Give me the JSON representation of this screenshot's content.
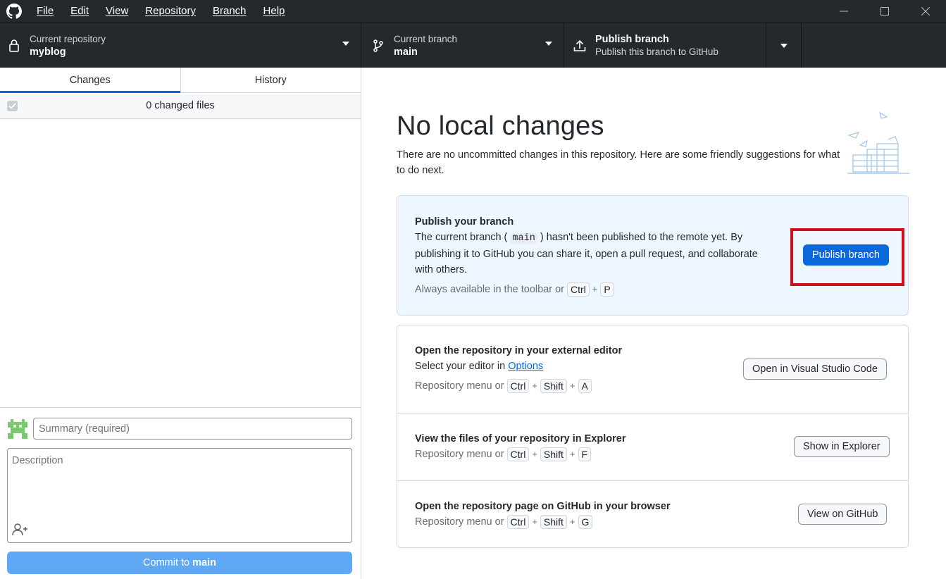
{
  "menu": {
    "items": [
      "File",
      "Edit",
      "View",
      "Repository",
      "Branch",
      "Help"
    ]
  },
  "toolbar": {
    "repo_label": "Current repository",
    "repo_value": "myblog",
    "branch_label": "Current branch",
    "branch_value": "main",
    "publish_title": "Publish branch",
    "publish_sub": "Publish this branch to GitHub"
  },
  "sidebar": {
    "tabs": [
      "Changes",
      "History"
    ],
    "active_tab": "Changes",
    "changed_files": "0 changed files",
    "summary_placeholder": "Summary (required)",
    "description_placeholder": "Description",
    "commit_prefix": "Commit to",
    "commit_branch": "main"
  },
  "main": {
    "heading": "No local changes",
    "subheading": "There are no uncommitted changes in this repository. Here are some friendly suggestions for what to do next.",
    "publish_card": {
      "title": "Publish your branch",
      "desc_before": "The current branch (",
      "desc_code": "main",
      "desc_after": ") hasn't been published to the remote yet. By publishing it to GitHub you can share it, open a pull request, and collaborate with others.",
      "hint": "Always available in the toolbar or",
      "keys": [
        "Ctrl",
        "P"
      ],
      "button": "Publish branch"
    },
    "editor_row": {
      "title": "Open the repository in your external editor",
      "desc": "Select your editor in",
      "link": "Options",
      "hint": "Repository menu or",
      "keys": [
        "Ctrl",
        "Shift",
        "A"
      ],
      "button": "Open in Visual Studio Code"
    },
    "explorer_row": {
      "title": "View the files of your repository in Explorer",
      "hint": "Repository menu or",
      "keys": [
        "Ctrl",
        "Shift",
        "F"
      ],
      "button": "Show in Explorer"
    },
    "github_row": {
      "title": "Open the repository page on GitHub in your browser",
      "hint": "Repository menu or",
      "keys": [
        "Ctrl",
        "Shift",
        "G"
      ],
      "button": "View on GitHub"
    }
  },
  "colors": {
    "titlebar": "#24292e",
    "accent": "#0969da",
    "highlight": "#d00f1e"
  }
}
